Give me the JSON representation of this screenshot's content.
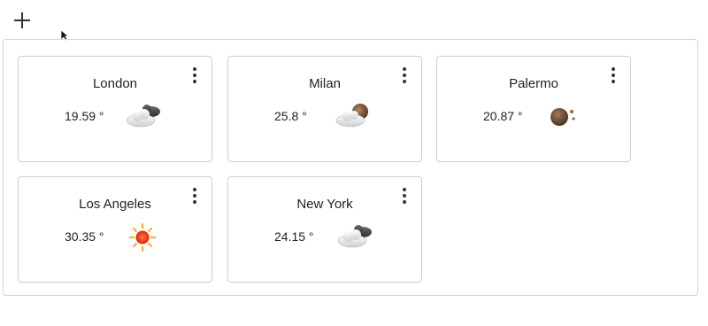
{
  "toolbar": {
    "add_icon": "plus-icon"
  },
  "cards": [
    {
      "city": "London",
      "temperature": "19.59 °",
      "weather_icon": "partly-cloudy-icon"
    },
    {
      "city": "Milan",
      "temperature": "25.8 °",
      "weather_icon": "partly-cloudy-icon"
    },
    {
      "city": "Palermo",
      "temperature": "20.87 °",
      "weather_icon": "clear-night-icon"
    },
    {
      "city": "Los Angeles",
      "temperature": "30.35 °",
      "weather_icon": "sun-icon"
    },
    {
      "city": "New York",
      "temperature": "24.15 °",
      "weather_icon": "partly-cloudy-icon"
    }
  ],
  "colors": {
    "border": "#cfcfcf",
    "text": "#222222",
    "sun": "#ff4a1a",
    "moon": "#6b4a32"
  }
}
